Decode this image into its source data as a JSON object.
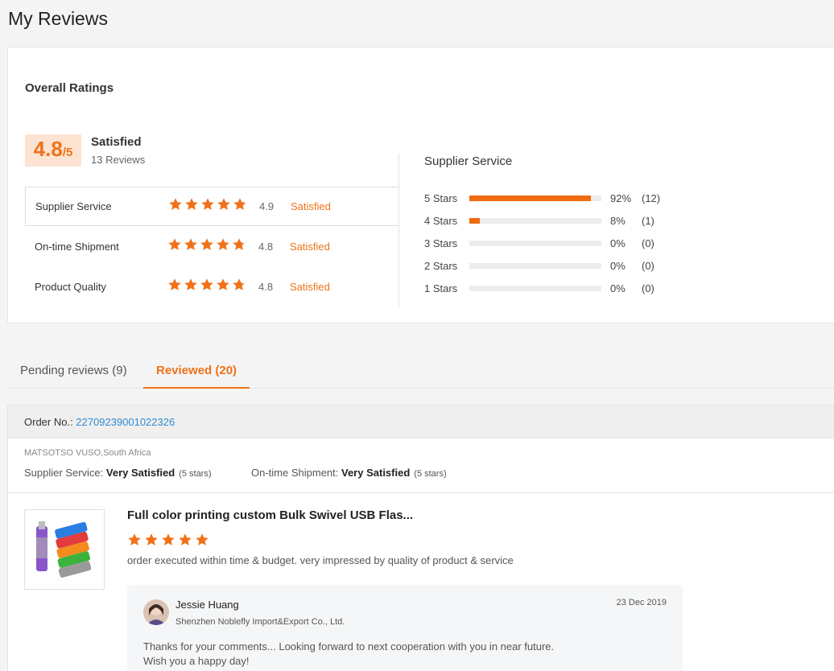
{
  "page": {
    "title": "My Reviews"
  },
  "overall": {
    "title": "Overall Ratings",
    "score": "4.8",
    "score_suffix": "/5",
    "label": "Satisfied",
    "count": "13 Reviews",
    "metrics": [
      {
        "name": "Supplier Service",
        "score": "4.9",
        "status": "Satisfied",
        "stars": 4.9
      },
      {
        "name": "On-time Shipment",
        "score": "4.8",
        "status": "Satisfied",
        "stars": 4.8
      },
      {
        "name": "Product Quality",
        "score": "4.8",
        "status": "Satisfied",
        "stars": 4.8
      }
    ]
  },
  "distribution": {
    "title": "Supplier Service",
    "rows": [
      {
        "label": "5  Stars",
        "pct": "92%",
        "count": "(12)",
        "fraction": 0.92
      },
      {
        "label": "4  Stars",
        "pct": "8%",
        "count": "(1)",
        "fraction": 0.08
      },
      {
        "label": "3  Stars",
        "pct": "0%",
        "count": "(0)",
        "fraction": 0
      },
      {
        "label": "2  Stars",
        "pct": "0%",
        "count": "(0)",
        "fraction": 0
      },
      {
        "label": "1  Stars",
        "pct": "0%",
        "count": "(0)",
        "fraction": 0
      }
    ]
  },
  "tabs": [
    {
      "label": "Pending reviews (9)",
      "active": false
    },
    {
      "label": "Reviewed (20)",
      "active": true
    }
  ],
  "order": {
    "prefix": "Order No.: ",
    "number": "22709239001022326",
    "buyer_location": "MATSOTSO VUSO,South Africa",
    "supplier_service_label": "Supplier Service: ",
    "supplier_service_value": "Very Satisfied",
    "supplier_service_stars": "(5 stars)",
    "shipment_label": "On-time Shipment: ",
    "shipment_value": "Very Satisfied",
    "shipment_stars": "(5 stars)",
    "product_title": "Full color printing custom Bulk Swivel USB Flas...",
    "review_stars": 5,
    "review_text": "order executed within time & budget. very impressed by quality of product & service",
    "reply": {
      "name": "Jessie Huang",
      "company": "Shenzhen Noblefly Import&Export Co., Ltd.",
      "date": "23 Dec 2019",
      "line1": "Thanks for your comments... Looking forward to next cooperation with you in near future.",
      "line2": "Wish you a happy day!"
    }
  },
  "colors": {
    "accent": "#f07218",
    "link": "#2f8ad0",
    "bar": "#f06a0f"
  }
}
